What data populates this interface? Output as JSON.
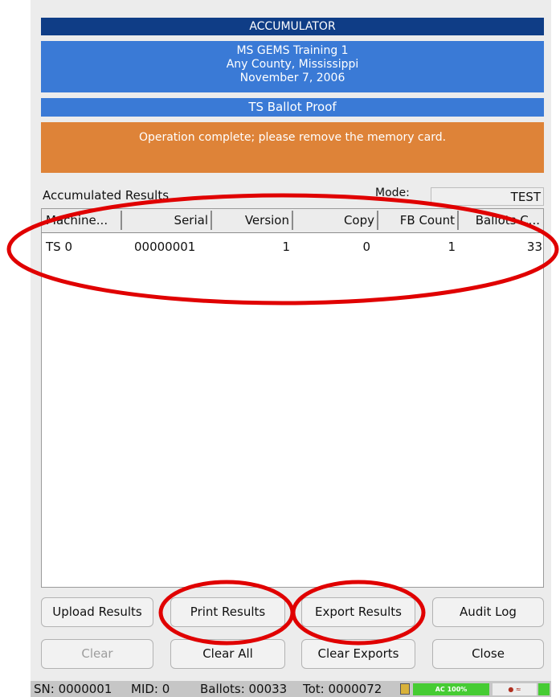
{
  "header": {
    "title": "ACCUMULATOR",
    "election": "MS GEMS Training 1",
    "jurisdiction": "Any County, Mississippi",
    "date": "November 7, 2006",
    "report": "TS Ballot Proof",
    "notice": "Operation complete; please remove the memory card."
  },
  "results": {
    "label": "Accumulated Results",
    "mode_label": "Mode:",
    "mode_value": "TEST",
    "columns": [
      "Machine...",
      "Serial",
      "Version",
      "Copy",
      "FB Count",
      "Ballots C..."
    ],
    "rows": [
      [
        "TS 0",
        "00000001",
        "1",
        "0",
        "1",
        "33"
      ]
    ]
  },
  "buttons": {
    "upload": "Upload Results",
    "print": "Print Results",
    "export": "Export Results",
    "audit": "Audit Log",
    "clear": "Clear",
    "clear_all": "Clear All",
    "clear_exports": "Clear Exports",
    "close": "Close"
  },
  "status": {
    "sn": "SN: 0000001",
    "mid": "MID: 0",
    "ballots": "Ballots: 00033",
    "tot": "Tot: 0000072",
    "power": "AC 100%",
    "power_level_percent": 100
  },
  "colors": {
    "title_bar": "#0f3d86",
    "info_bar": "#3a7ad6",
    "notice_bar": "#de8338",
    "annotation": "#e00000"
  }
}
